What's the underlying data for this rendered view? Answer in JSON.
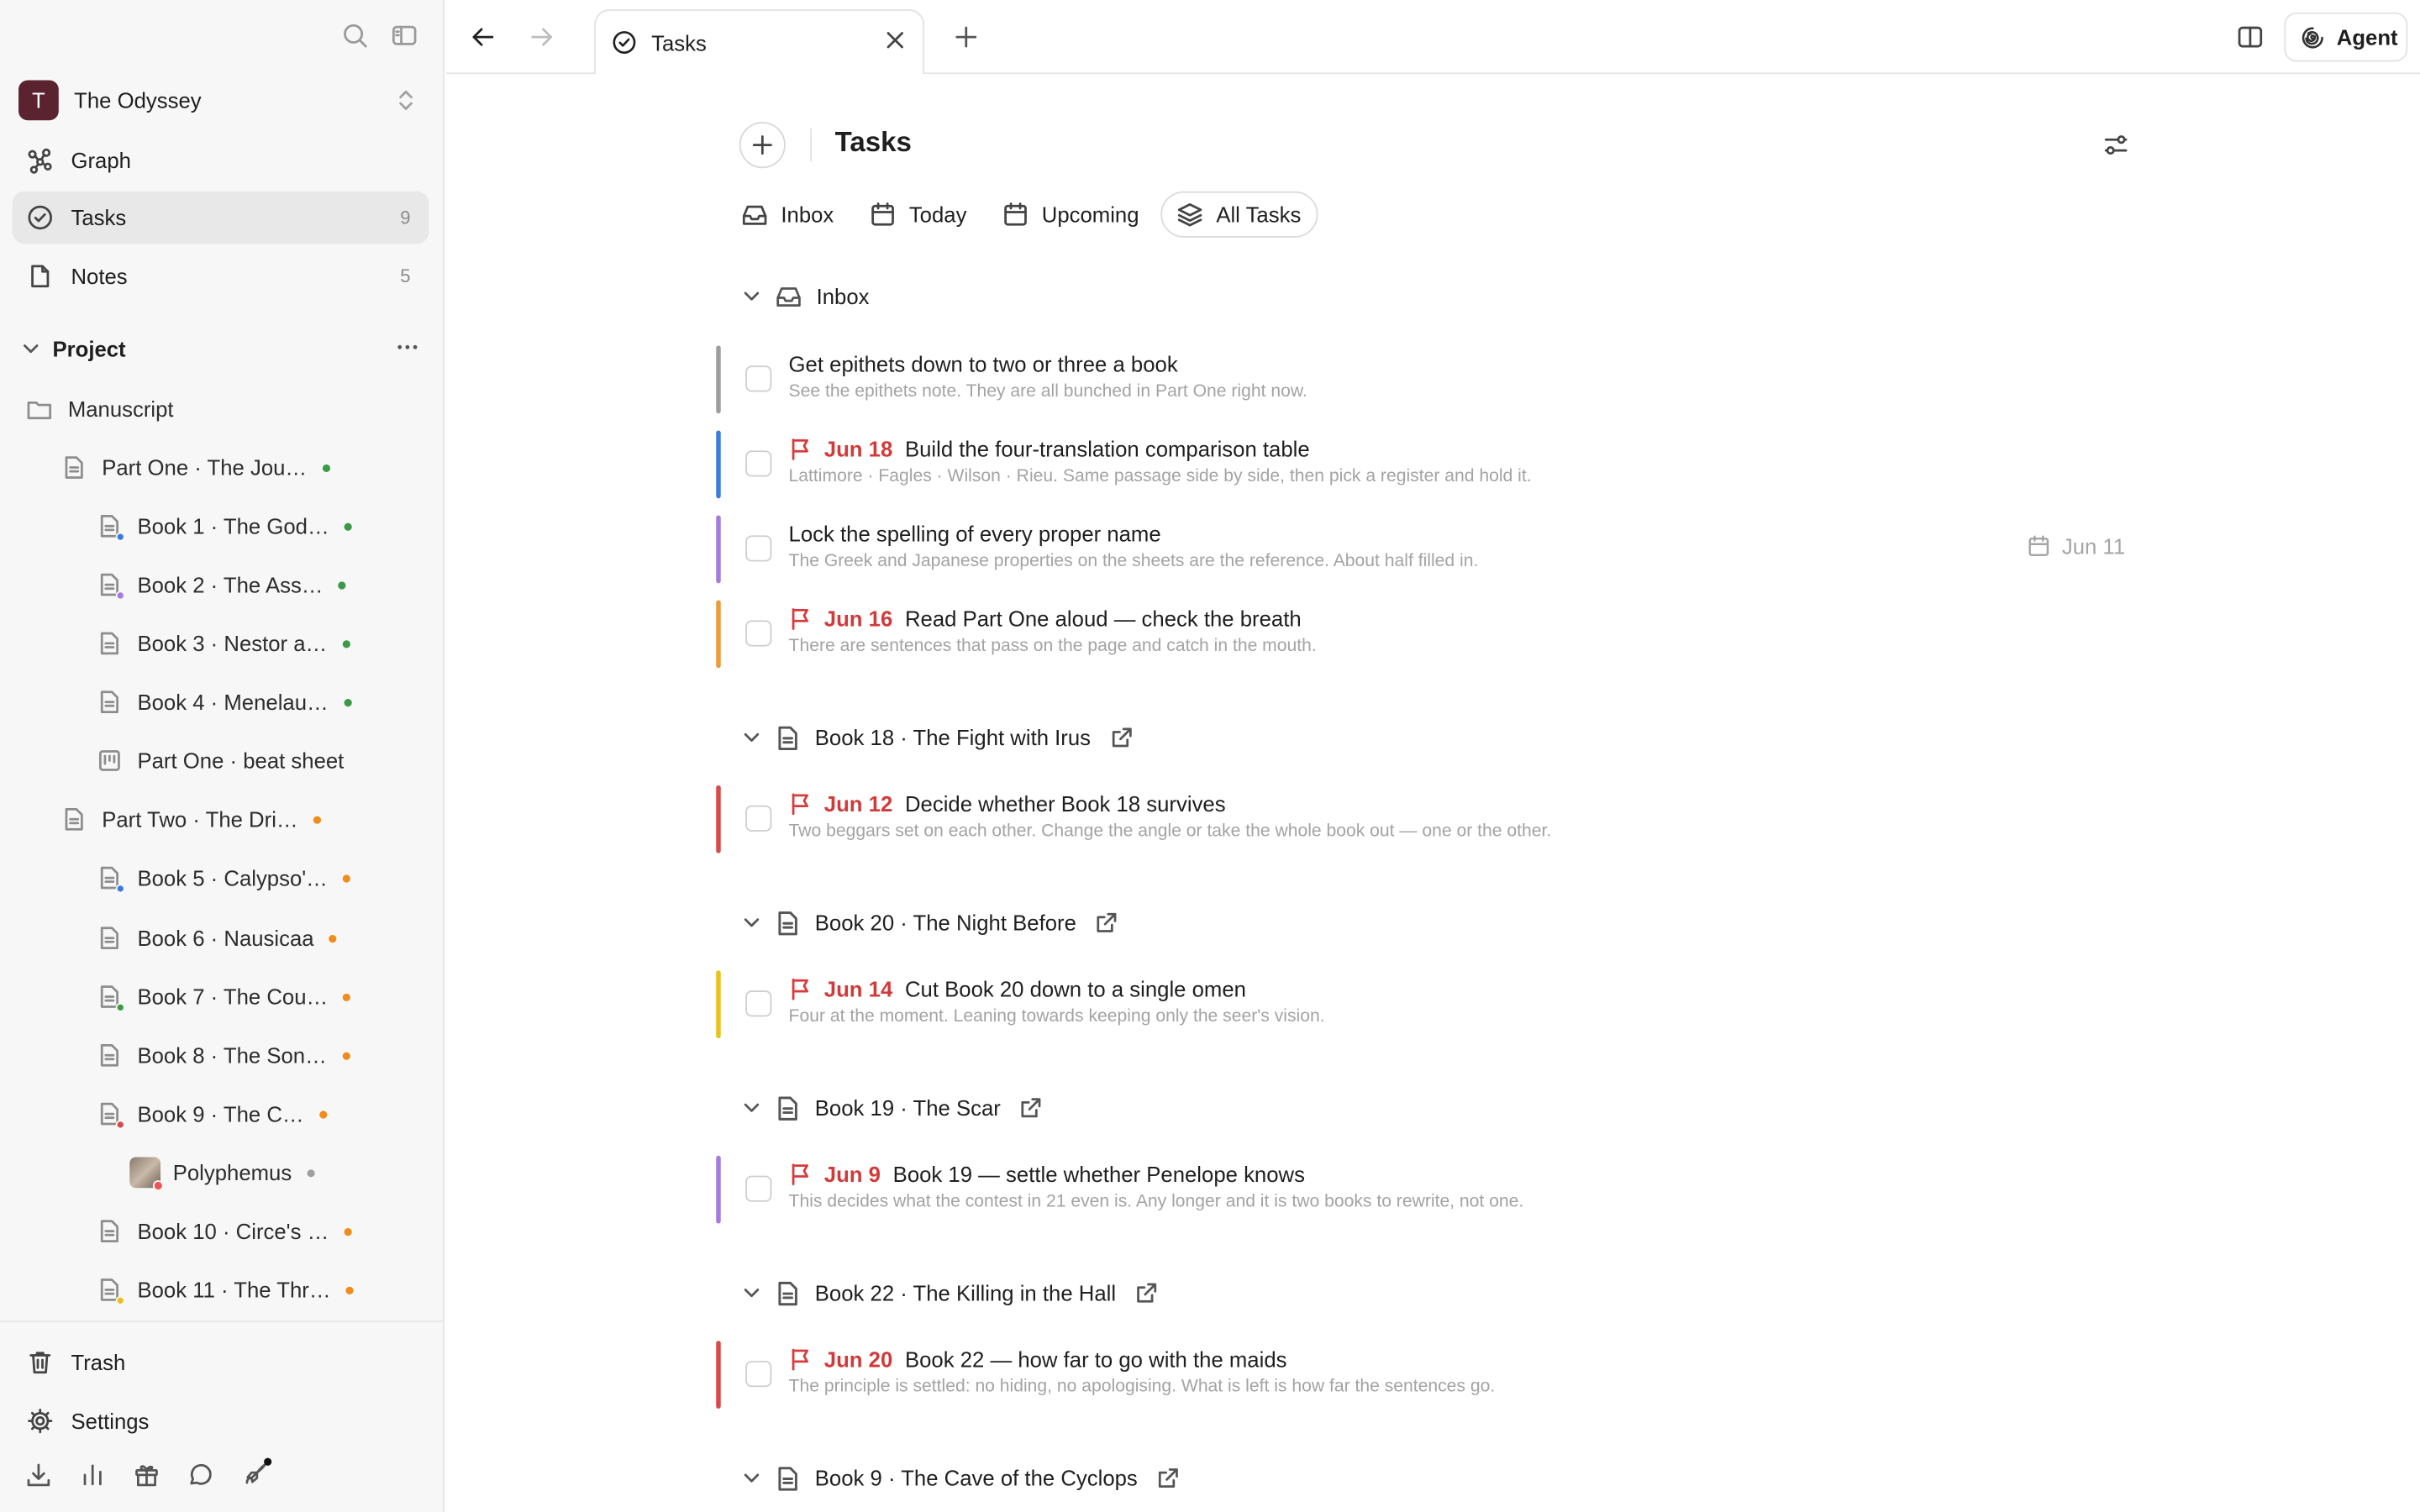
{
  "workspace": {
    "initial": "T",
    "name": "The Odyssey"
  },
  "nav": [
    {
      "label": "Graph",
      "count": ""
    },
    {
      "label": "Tasks",
      "count": "9"
    },
    {
      "label": "Notes",
      "count": "5"
    }
  ],
  "project": {
    "label": "Project"
  },
  "tree": [
    {
      "label": "Manuscript"
    },
    {
      "label": "Part One · The Jou…"
    },
    {
      "label": "Book 1 · The God…"
    },
    {
      "label": "Book 2 · The Ass…"
    },
    {
      "label": "Book 3 · Nestor a…"
    },
    {
      "label": "Book 4 · Menelau…"
    },
    {
      "label": "Part One · beat sheet"
    },
    {
      "label": "Part Two · The Dri…"
    },
    {
      "label": "Book 5 · Calypso'…"
    },
    {
      "label": "Book 6 · Nausicaa"
    },
    {
      "label": "Book 7 · The Cou…"
    },
    {
      "label": "Book 8 · The Son…"
    },
    {
      "label": "Book 9 · The C…"
    },
    {
      "label": "Polyphemus"
    },
    {
      "label": "Book 10 · Circe's …"
    },
    {
      "label": "Book 11 · The Thr…"
    }
  ],
  "sidebar_footer": {
    "trash": "Trash",
    "settings": "Settings"
  },
  "tab": {
    "label": "Tasks"
  },
  "agent": {
    "label": "Agent"
  },
  "page": {
    "title": "Tasks"
  },
  "views": [
    {
      "label": "Inbox"
    },
    {
      "label": "Today"
    },
    {
      "label": "Upcoming"
    },
    {
      "label": "All Tasks"
    }
  ],
  "groups": [
    {
      "label": "Inbox"
    },
    {
      "label": "Book 18 · The Fight with Irus"
    },
    {
      "label": "Book 20 · The Night Before"
    },
    {
      "label": "Book 19 · The Scar"
    },
    {
      "label": "Book 22 · The Killing in the Hall"
    },
    {
      "label": "Book 9 · The Cave of the Cyclops"
    }
  ],
  "tasks": [
    {
      "due": "",
      "title": "Get epithets down to two or three a book",
      "desc": "See the epithets note. They are all bunched in Part One right now.",
      "color": "#9e9e9e"
    },
    {
      "due": "Jun 18",
      "title": "Build the four-translation comparison table",
      "desc": "Lattimore · Fagles · Wilson · Rieu. Same passage side by side, then pick a register and hold it.",
      "color": "#3b7ddd"
    },
    {
      "due": "",
      "title": "Lock the spelling of every proper name",
      "desc": "The Greek and Japanese properties on the sheets are the reference. About half filled in.",
      "color": "#a57be0",
      "right_date": "Jun 11"
    },
    {
      "due": "Jun 16",
      "title": "Read Part One aloud — check the breath",
      "desc": "There are sentences that pass on the page and catch in the mouth.",
      "color": "#ef9b3a"
    },
    {
      "due": "Jun 12",
      "title": "Decide whether Book 18 survives",
      "desc": "Two beggars set on each other. Change the angle or take the whole book out — one or the other.",
      "color": "#d94a4a"
    },
    {
      "due": "Jun 14",
      "title": "Cut Book 20 down to a single omen",
      "desc": "Four at the moment. Leaning towards keeping only the seer's vision.",
      "color": "#e9c21e"
    },
    {
      "due": "Jun 9",
      "title": "Book 19 — settle whether Penelope knows",
      "desc": "This decides what the contest in 21 even is. Any longer and it is two books to rewrite, not one.",
      "color": "#a57be0"
    },
    {
      "due": "Jun 20",
      "title": "Book 22 — how far to go with the maids",
      "desc": "The principle is settled: no hiding, no apologising. What is left is how far the sentences go.",
      "color": "#d94a4a"
    }
  ]
}
